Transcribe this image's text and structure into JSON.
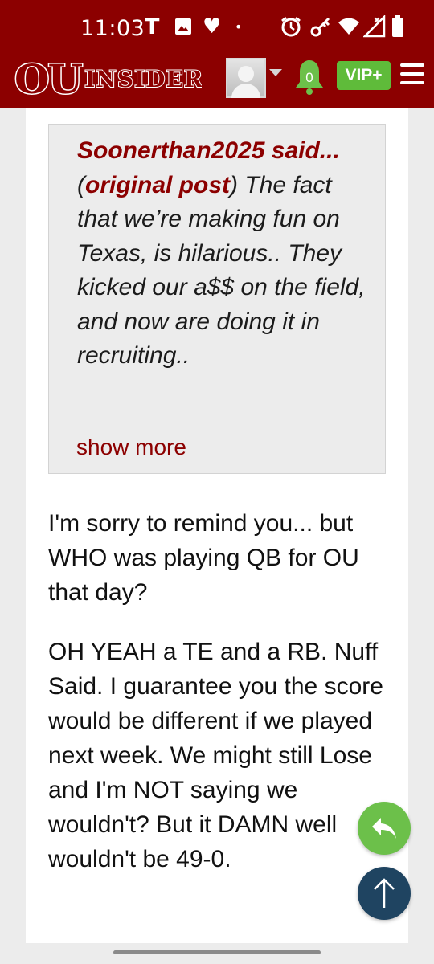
{
  "status_bar": {
    "time": "11:03",
    "icons": [
      "t-mobile-icon",
      "image-icon",
      "heart-icon",
      "dot-icon",
      "alarm-icon",
      "key-icon",
      "wifi-icon",
      "signal-icon",
      "battery-icon"
    ],
    "t_glyph": "T",
    "heart_glyph": "♥",
    "dot_glyph": "•"
  },
  "header": {
    "logo_primary": "OU",
    "logo_secondary": "INSIDER",
    "notification_count": "0",
    "vip_label": "VIP+",
    "colors": {
      "brand": "#8c0000",
      "vip": "#5fbb3a",
      "bell": "#6cc04a"
    }
  },
  "quote": {
    "author": "Soonerthan2025",
    "said": "said...",
    "open_paren": "(",
    "original_link": "original post",
    "close_paren": ")",
    "text": "The fact that we’re making fun on Texas, is hilarious.. They kicked our a$$ on the field, and now are doing it in recruiting..",
    "show_more": "show more"
  },
  "post": {
    "paragraph_1": "I'm sorry to remind you... but WHO was playing QB for OU that day?",
    "paragraph_2": "OH YEAH a TE and a RB. Nuff Said. I guarantee you the score would be different if we played next week. We might still Lose and I'm NOT saying we wouldn't? But it DAMN well wouldn't be 49-0."
  },
  "fabs": {
    "reply_icon": "reply-icon",
    "top_icon": "arrow-up-icon",
    "colors": {
      "reply": "#6cc04a",
      "top": "#1f4461"
    }
  }
}
